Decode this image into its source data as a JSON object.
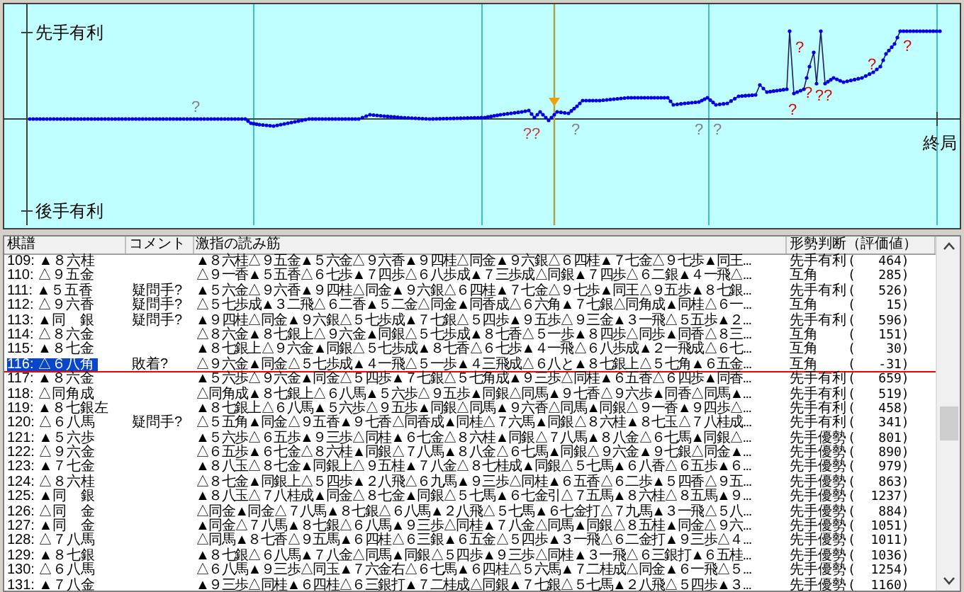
{
  "chart": {
    "top_label": "先手有利",
    "bottom_label": "後手有利",
    "end_label": "終局",
    "marks": [
      {
        "text": "?",
        "color": "#808080"
      },
      {
        "text": "??",
        "color": "#c04040"
      },
      {
        "text": "?",
        "color": "#808080"
      },
      {
        "text": "?",
        "color": "#808080"
      },
      {
        "text": "?",
        "color": "#808080"
      },
      {
        "text": "?",
        "color": "#e00000"
      },
      {
        "text": "?",
        "color": "#e00000"
      },
      {
        "text": "?",
        "color": "#e00000"
      },
      {
        "text": "??",
        "color": "#e00000"
      },
      {
        "text": "?",
        "color": "#e00000"
      },
      {
        "text": "?",
        "color": "#e00000"
      }
    ]
  },
  "table": {
    "columns": [
      "棋譜",
      "コメント",
      "激指の読み筋",
      "形勢判断（評価値）"
    ],
    "rows": [
      {
        "move": "109: ▲８六桂",
        "line": "▲８六桂△９五金▲５六金△９六香▲９四桂△同金▲９六銀△６四桂▲７七金△９七歩▲同王...",
        "judgment": "先手有利",
        "score": "(   464)",
        "selected": false
      },
      {
        "move": "110: △９五金",
        "line": "△９一香▲５五香△６七歩▲７四歩△６八歩成▲７三歩成△同銀▲７四歩△６二銀▲４一飛△...",
        "judgment": "互角",
        "score": "(   285)",
        "selected": false
      },
      {
        "move": "111: ▲５五香",
        "comment": "疑問手?",
        "line": "▲５六金△９六香▲９四桂△同金▲９六銀△６四桂▲７七金△９七歩▲同王△９五歩▲８七銀...",
        "judgment": "先手有利",
        "score": "(   526)",
        "selected": false
      },
      {
        "move": "112: △９六香",
        "comment": "疑問手?",
        "line": "△５七歩成▲３二飛△６二香▲５二金△同金▲同香成△６六角▲７七銀△同角成▲同桂△６一...",
        "judgment": "互角",
        "score": "(    15)",
        "selected": false
      },
      {
        "move": "113: ▲同　銀",
        "comment": "疑問手?",
        "line": "▲９四桂△同金▲９六銀△５七歩成▲７七銀△５四歩▲９五歩△９三金▲３一飛△５五歩▲２...",
        "judgment": "先手有利",
        "score": "(   596)",
        "selected": false
      },
      {
        "move": "114: △８六金",
        "line": "△８六金▲８七銀上△９六金▲同銀△５七歩成▲８七香△５一歩▲８四歩△同歩▲同香△８三...",
        "judgment": "互角",
        "score": "(   151)",
        "selected": false
      },
      {
        "move": "115: ▲８七金",
        "line": "▲８七銀上△９六金▲同銀△５七歩成▲８七香△６七歩▲４一飛△６八歩成▲２一飛成△６七...",
        "judgment": "互角",
        "score": "(    30)",
        "selected": false
      },
      {
        "move": "116: △６八角",
        "comment": "敗着?",
        "line": "△９六金▲同金△５七歩成▲４一飛△５一歩▲４三飛成△６八と▲８七銀上△５七角▲６五金...",
        "judgment": "互角",
        "score": "(   -31)",
        "selected": true
      },
      {
        "move": "117: ▲８六金",
        "line": "▲５六歩△９六金▲同金△５四歩▲７七銀△５七角成▲９三歩△同桂▲６五香△６四歩▲同香...",
        "judgment": "先手有利",
        "score": "(   659)",
        "selected": false
      },
      {
        "move": "118: △同角成",
        "line": "△同角成▲８七銀上△６八馬▲５六歩△９五歩▲同銀△同馬▲９七香△９六歩▲同香△同馬▲...",
        "judgment": "先手有利",
        "score": "(   519)",
        "selected": false
      },
      {
        "move": "119: ▲８七銀左",
        "line": "▲８七銀上△６八馬▲５六歩△９五歩▲同銀△同馬▲９六香△同馬▲同銀△９一香▲９四歩△...",
        "judgment": "先手有利",
        "score": "(   458)",
        "selected": false
      },
      {
        "move": "120: △６八馬",
        "comment": "疑問手?",
        "line": "△５五角▲同金△９五香▲９七香△同香成▲同桂△７六馬▲同銀△８六桂▲８七玉△７八桂成...",
        "judgment": "先手有利",
        "score": "(   341)",
        "selected": false
      },
      {
        "move": "121: ▲５六歩",
        "line": "▲５六歩△６五歩▲９三歩△同桂▲６七金△８六桂▲同銀△７八馬▲８八金△６七馬▲同銀△...",
        "judgment": "先手優勢",
        "score": "(   801)",
        "selected": false
      },
      {
        "move": "122: △９六金",
        "line": "△６五歩▲６七金△８六桂▲同銀△７八馬▲８八金△６七馬▲同銀△９六金▲９七銀△同金▲...",
        "judgment": "先手優勢",
        "score": "(   890)",
        "selected": false
      },
      {
        "move": "123: ▲７七金",
        "line": "▲８八玉△８七金▲同銀上△９五桂▲７八金△８七桂成▲同銀△５七馬▲６八香△６五歩▲６...",
        "judgment": "先手優勢",
        "score": "(   979)",
        "selected": false
      },
      {
        "move": "124: △８六桂",
        "line": "△８七金▲同銀上△５四歩▲２八飛△６九馬▲９三歩△同桂▲６五香△６二歩▲５四香△９五...",
        "judgment": "先手優勢",
        "score": "(   863)",
        "selected": false
      },
      {
        "move": "125: ▲同　銀",
        "line": "▲８八玉△７八桂成▲同金△８七金▲同銀△５七馬▲６七金引△７五馬▲８六桂△８五馬▲９...",
        "judgment": "先手優勢",
        "score": "(  1237)",
        "selected": false
      },
      {
        "move": "126: △同　金",
        "line": "△同金▲同金△７八馬▲８七銀△６八馬▲２八飛△５七馬▲６七金打△７九馬▲３一飛△５八...",
        "judgment": "先手優勢",
        "score": "(   884)",
        "selected": false
      },
      {
        "move": "127: ▲同　金",
        "line": "▲同金△７八馬▲８七銀△６八馬▲９三歩△同桂▲７八金△同馬▲同銀△８五桂▲同金△９六...",
        "judgment": "先手優勢",
        "score": "(  1051)",
        "selected": false
      },
      {
        "move": "128: △７八馬",
        "line": "△同馬▲８七香△９五馬▲６四桂△６三銀▲６五金△５四歩▲３一飛△６二金打▲９三歩△４...",
        "judgment": "先手優勢",
        "score": "(  1011)",
        "selected": false
      },
      {
        "move": "129: ▲８七銀",
        "line": "▲８七銀△６八馬▲７八金△同馬▲同銀△５四歩▲９三歩△同桂▲３一飛△６三銀打▲６五桂...",
        "judgment": "先手優勢",
        "score": "(  1036)",
        "selected": false
      },
      {
        "move": "130: △６八馬",
        "line": "△６八馬▲９三歩△同玉▲７六金右△６七馬▲６四桂△５六馬▲７二桂成△同金▲６一飛△５...",
        "judgment": "先手優勢",
        "score": "(  1254)",
        "selected": false
      },
      {
        "move": "131: ▲７八金",
        "line": "▲９三歩△同桂▲６四桂△６三銀打▲７二桂成△同銀▲７七銀△５七馬▲２八飛△５四歩▲３...",
        "judgment": "先手優勢",
        "score": "(  1160)",
        "selected": false
      }
    ]
  }
}
